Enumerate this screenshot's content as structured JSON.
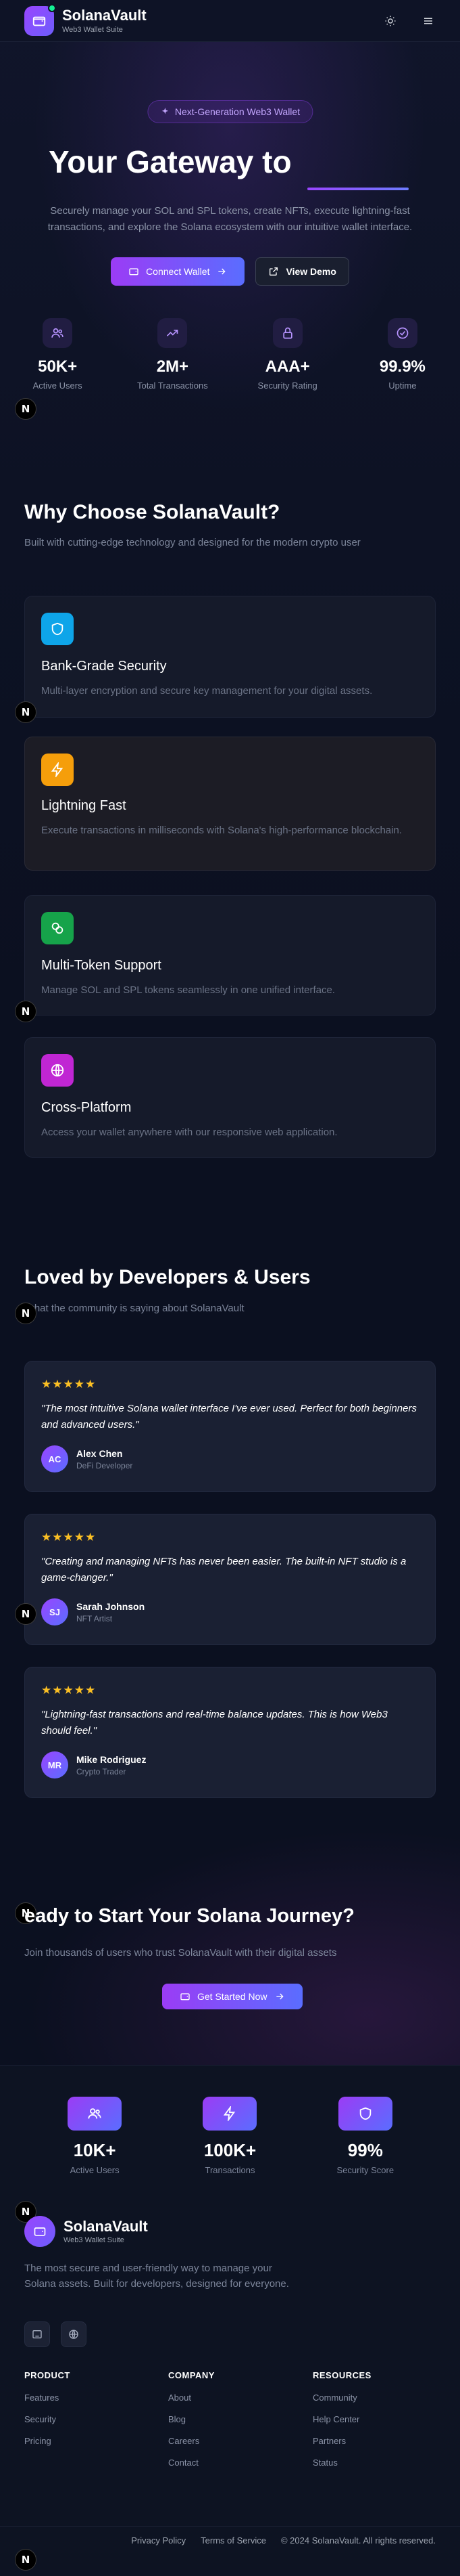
{
  "header": {
    "brand": "SolanaVault",
    "brand_sub": "Web3 Wallet Suite",
    "icons": [
      "sun-icon",
      "menu-icon"
    ]
  },
  "hero": {
    "badge": "Next-Generation Web3 Wallet",
    "title": "Your Gateway to",
    "subtitle": "Securely manage your SOL and SPL tokens, create NFTs, execute lightning-fast transactions, and explore the Solana ecosystem with our intuitive wallet interface.",
    "primary_button": "Connect Wallet",
    "secondary_button": "View Demo",
    "stats": [
      {
        "value": "50K+",
        "label": "Active Users",
        "icon": "users-icon"
      },
      {
        "value": "2M+",
        "label": "Total Transactions",
        "icon": "trending-up-icon"
      },
      {
        "value": "AAA+",
        "label": "Security Rating",
        "icon": "lock-icon"
      },
      {
        "value": "99.9%",
        "label": "Uptime",
        "icon": "check-circle-icon"
      }
    ]
  },
  "features": {
    "title": "Why Choose SolanaVault?",
    "subtitle": "Built with cutting-edge technology and designed for the modern crypto user",
    "items": [
      {
        "title": "Bank-Grade Security",
        "desc": "Multi-layer encryption and secure key management for your digital assets.",
        "icon": "shield-icon",
        "color": "#0ea5e9"
      },
      {
        "title": "Lightning Fast",
        "desc": "Execute transactions in milliseconds with Solana's high-performance blockchain.",
        "icon": "zap-icon",
        "color": "#f59e0b"
      },
      {
        "title": "Multi-Token Support",
        "desc": "Manage SOL and SPL tokens seamlessly in one unified interface.",
        "icon": "coins-icon",
        "color": "#16a34a"
      },
      {
        "title": "Cross-Platform",
        "desc": "Access your wallet anywhere with our responsive web application.",
        "icon": "globe-icon",
        "color": "#c026d3"
      }
    ]
  },
  "testimonials": {
    "title": "Loved by Developers & Users",
    "subtitle": "what the community is saying about SolanaVault",
    "stars": "★★★★★",
    "items": [
      {
        "quote": "\"The most intuitive Solana wallet interface I've ever used. Perfect for both beginners and advanced users.\"",
        "initials": "AC",
        "name": "Alex Chen",
        "role": "DeFi Developer"
      },
      {
        "quote": "\"Creating and managing NFTs has never been easier. The built-in NFT studio is a game-changer.\"",
        "initials": "SJ",
        "name": "Sarah Johnson",
        "role": "NFT Artist"
      },
      {
        "quote": "\"Lightning-fast transactions and real-time balance updates. This is how Web3 should feel.\"",
        "initials": "MR",
        "name": "Mike Rodriguez",
        "role": "Crypto Trader"
      }
    ]
  },
  "cta": {
    "title": "eady to Start Your Solana Journey?",
    "subtitle": "Join thousands of users who trust SolanaVault with their digital assets",
    "button": "Get Started Now"
  },
  "footer": {
    "stats": [
      {
        "value": "10K+",
        "label": "Active Users",
        "icon": "users-icon"
      },
      {
        "value": "100K+",
        "label": "Transactions",
        "icon": "zap-icon"
      },
      {
        "value": "99%",
        "label": "Security Score",
        "icon": "shield-icon"
      }
    ],
    "brand": "SolanaVault",
    "brand_sub": "Web3 Wallet Suite",
    "description": "The most secure and user-friendly way to manage your Solana assets. Built for developers, designed for everyone.",
    "columns": [
      {
        "heading": "PRODUCT",
        "links": [
          "Features",
          "Security",
          "Pricing"
        ]
      },
      {
        "heading": "COMPANY",
        "links": [
          "About",
          "Blog",
          "Careers",
          "Contact"
        ]
      },
      {
        "heading": "RESOURCES",
        "links": [
          "Community",
          "Help Center",
          "Partners",
          "Status"
        ]
      }
    ],
    "legal": [
      "Privacy Policy",
      "Terms of Service",
      "© 2024 SolanaVault. All rights reserved."
    ]
  },
  "dev_badge": "N"
}
